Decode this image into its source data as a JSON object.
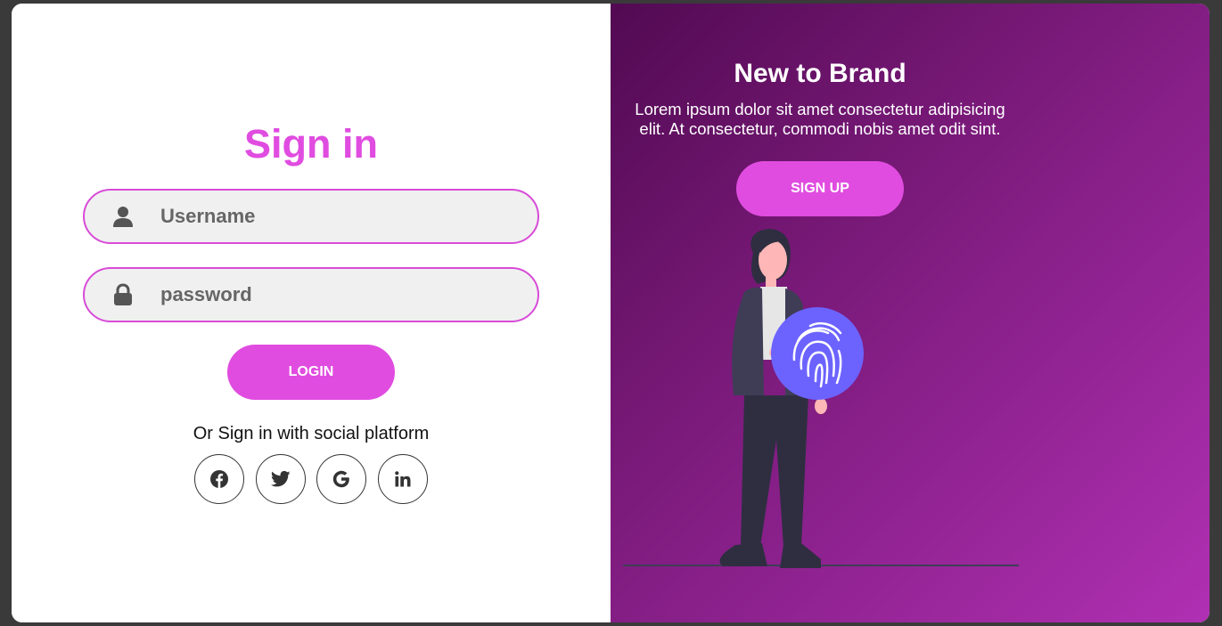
{
  "signin": {
    "title": "Sign in",
    "username_placeholder": "Username",
    "password_placeholder": "password",
    "login_label": "LOGIN",
    "social_text": "Or Sign in with social platform",
    "social": [
      "facebook-icon",
      "twitter-icon",
      "google-icon",
      "linkedin-icon"
    ]
  },
  "panel": {
    "title": "New to Brand",
    "text": "Lorem ipsum dolor sit amet consectetur adipisicing elit. At consectetur, commodi nobis amet odit sint.",
    "signup_label": "SIGN UP"
  },
  "colors": {
    "accent": "#e04ce0",
    "panel_gradient_start": "#520a52",
    "panel_gradient_end": "#b030b3",
    "fingerprint": "#6c63ff"
  }
}
